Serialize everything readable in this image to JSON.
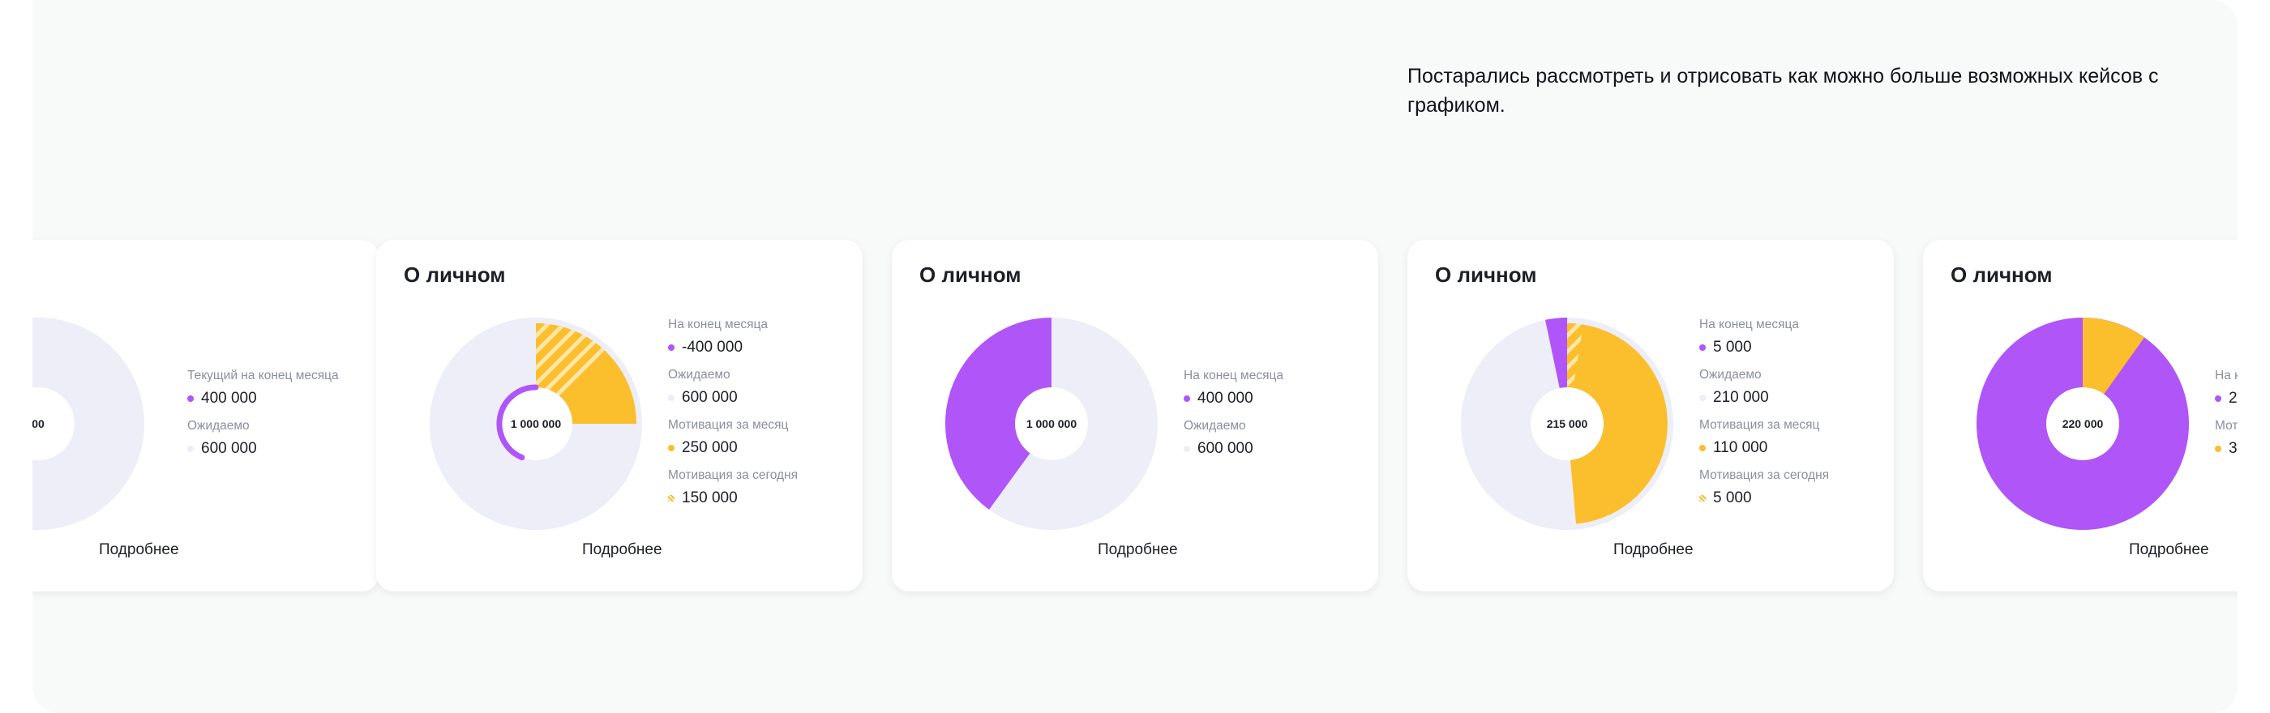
{
  "intro_text": "Постарались рассмотреть и отрисовать как можно больше возможных кейсов с графиком.",
  "colors": {
    "purple": "#b055f8",
    "yellow": "#fbbf2d",
    "track": "#edeef7",
    "hatch": "#fde7a8"
  },
  "cards": [
    {
      "title": "",
      "center": "00",
      "more": "Подробнее",
      "legend": [
        {
          "label": "Текущий на конец месяца",
          "value": "400 000",
          "dot": "purple"
        },
        {
          "label": "Ожидаемо",
          "value": "600 000",
          "dot": "track"
        }
      ]
    },
    {
      "title": "О личном",
      "center": "1 000 000",
      "more": "Подробнее",
      "legend": [
        {
          "label": "На конец месяца",
          "value": "-400 000",
          "dot": "purple"
        },
        {
          "label": "Ожидаемо",
          "value": "600 000",
          "dot": "track"
        },
        {
          "label": "Мотивация за месяц",
          "value": "250 000",
          "dot": "yellow"
        },
        {
          "label": "Мотивация за сегодня",
          "value": "150 000",
          "dot": "hatch"
        }
      ]
    },
    {
      "title": "О личном",
      "center": "1 000 000",
      "more": "Подробнее",
      "legend": [
        {
          "label": "На конец месяца",
          "value": "400 000",
          "dot": "purple"
        },
        {
          "label": "Ожидаемо",
          "value": "600 000",
          "dot": "track"
        }
      ]
    },
    {
      "title": "О личном",
      "center": "215 000",
      "more": "Подробнее",
      "legend": [
        {
          "label": "На конец месяца",
          "value": "5 000",
          "dot": "purple"
        },
        {
          "label": "Ожидаемо",
          "value": "210 000",
          "dot": "track"
        },
        {
          "label": "Мотивация за месяц",
          "value": "110 000",
          "dot": "yellow"
        },
        {
          "label": "Мотивация за сегодня",
          "value": "5 000",
          "dot": "hatch"
        }
      ]
    },
    {
      "title": "О личном",
      "center": "220 000",
      "more": "Подробнее",
      "legend": [
        {
          "label": "На к",
          "value": "2",
          "dot": "purple"
        },
        {
          "label": "Моти",
          "value": "3",
          "dot": "yellow"
        }
      ]
    }
  ]
}
